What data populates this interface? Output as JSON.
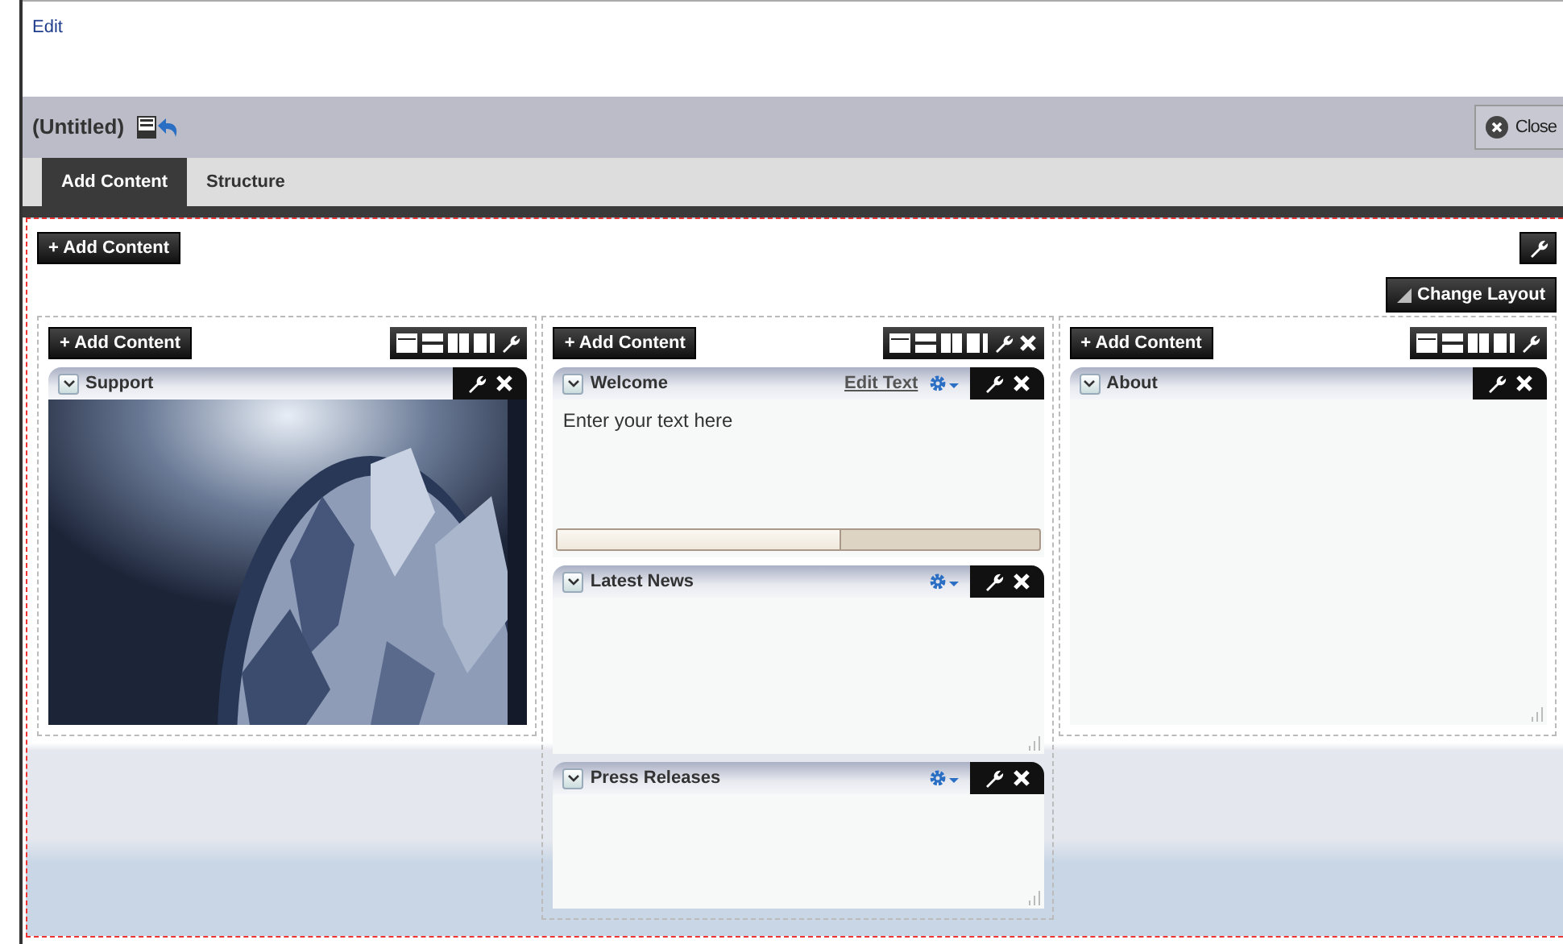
{
  "edit_link": "Edit",
  "page_title": "(Untitled)",
  "close_button": "Close",
  "tabs": [
    {
      "label": "Add Content",
      "selected": true
    },
    {
      "label": "Structure",
      "selected": false
    }
  ],
  "add_content_button": "+ Add Content",
  "change_layout_button": "Change Layout",
  "columns": [
    {
      "add_button": "+ Add Content",
      "removable": false,
      "panels": [
        {
          "title": "Support",
          "kind": "picture",
          "settings_menu": false
        }
      ]
    },
    {
      "add_button": "+ Add Content",
      "removable": true,
      "panels": [
        {
          "title": "Welcome",
          "kind": "text",
          "settings_menu": true,
          "edit_link": "Edit Text",
          "body": "Enter your text here"
        },
        {
          "title": "Latest News",
          "kind": "blank",
          "settings_menu": true
        },
        {
          "title": "Press Releases",
          "kind": "blank",
          "settings_menu": true
        }
      ]
    },
    {
      "add_button": "+ Add Content",
      "removable": false,
      "panels": [
        {
          "title": "About",
          "kind": "blank",
          "settings_menu": false
        }
      ]
    }
  ]
}
